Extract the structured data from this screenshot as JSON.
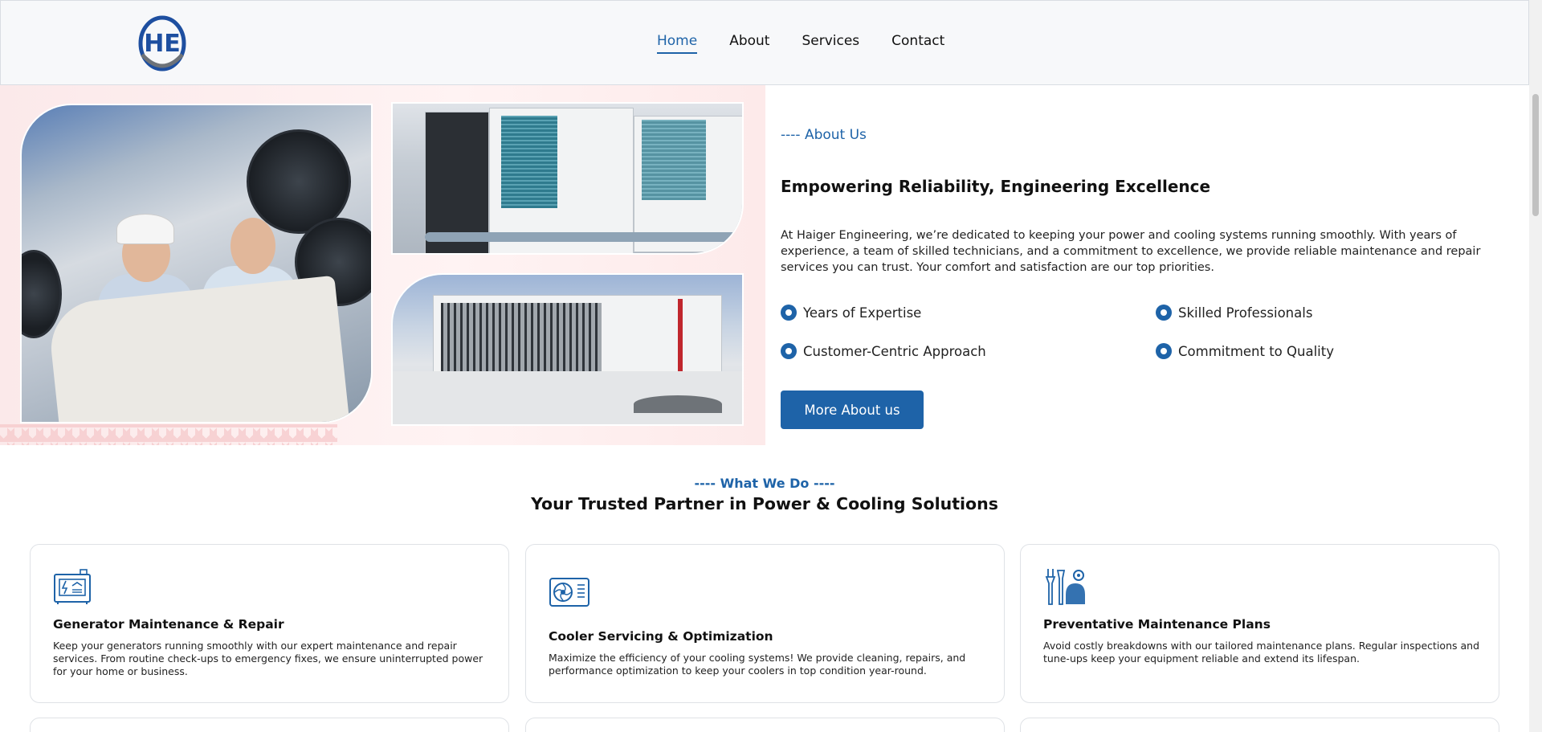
{
  "header": {
    "logo_text": "HE",
    "nav": [
      {
        "label": "Home",
        "active": true
      },
      {
        "label": "About",
        "active": false
      },
      {
        "label": "Services",
        "active": false
      },
      {
        "label": "Contact",
        "active": false
      }
    ]
  },
  "about": {
    "kicker": "---- About Us",
    "title": "Empowering Reliability, Engineering Excellence",
    "description": "At Haiger Engineering, we’re dedicated to keeping your power and cooling systems running smoothly. With years of experience, a team of skilled technicians, and a commitment to excellence, we provide reliable maintenance and repair services you can trust. Your comfort and satisfaction are our top priorities.",
    "features": [
      "Years of Expertise",
      "Skilled Professionals",
      "Customer-Centric Approach",
      "Commitment to Quality"
    ],
    "button_label": "More About us"
  },
  "what_we_do": {
    "kicker": "---- What We Do ----",
    "title": "Your Trusted Partner in Power & Cooling Solutions",
    "cards": [
      {
        "icon": "generator-icon",
        "title": "Generator Maintenance & Repair",
        "description": "Keep your generators running smoothly with our expert maintenance and repair services. From routine check-ups to emergency fixes, we ensure uninterrupted power for your home or business."
      },
      {
        "icon": "air-conditioner-icon",
        "title": "Cooler Servicing & Optimization",
        "description": "Maximize the efficiency of your cooling systems! We provide cleaning, repairs, and performance optimization to keep your coolers in top condition year-round."
      },
      {
        "icon": "maintenance-tools-icon",
        "title": "Preventative Maintenance Plans",
        "description": "Avoid costly breakdowns with our tailored maintenance plans. Regular inspections and tune-ups keep your equipment reliable and extend its lifespan."
      }
    ]
  },
  "colors": {
    "accent": "#1e63a8",
    "header_bg": "#f7f8fa",
    "hero_bg": "#fbe9ea"
  }
}
